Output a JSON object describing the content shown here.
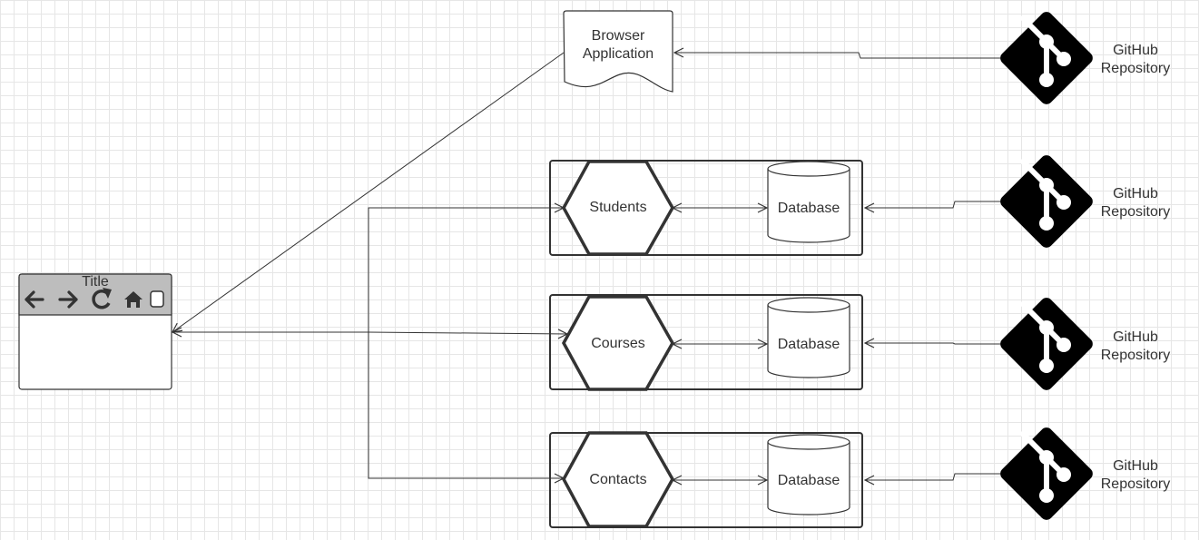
{
  "browser_window": {
    "title": "Title",
    "icons": [
      "back-arrow-icon",
      "forward-arrow-icon",
      "reload-icon",
      "home-icon",
      "menu-square-icon"
    ]
  },
  "browser_application": {
    "label_lines": [
      "Browser",
      "Application"
    ]
  },
  "services": [
    {
      "name": "Students",
      "database": "Database",
      "repo_lines": [
        "GitHub",
        "Repository"
      ]
    },
    {
      "name": "Courses",
      "database": "Database",
      "repo_lines": [
        "GitHub",
        "Repository"
      ]
    },
    {
      "name": "Contacts",
      "database": "Database",
      "repo_lines": [
        "GitHub",
        "Repository"
      ]
    }
  ],
  "top_repo": {
    "repo_lines": [
      "GitHub",
      "Repository"
    ],
    "icon": "git-logo-icon"
  },
  "colors": {
    "stroke": "#333333",
    "titlebar": "#bdbdbd",
    "icon": "#333333",
    "git": "#000000"
  }
}
